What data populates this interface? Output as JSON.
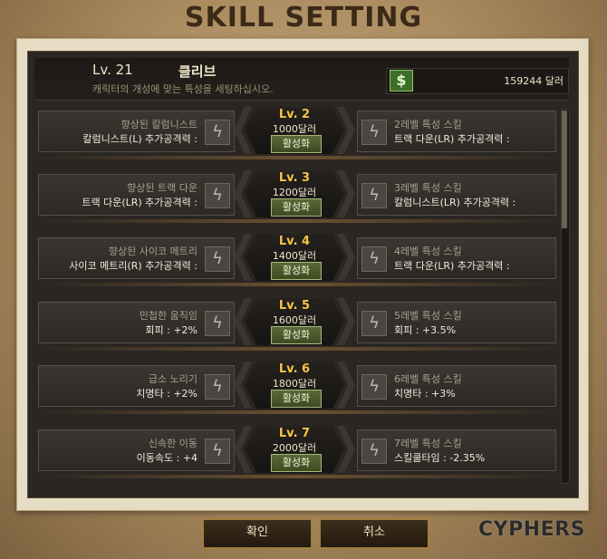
{
  "title": "SKILL SETTING",
  "header": {
    "level": "Lv. 21",
    "character": "클리브",
    "description": "캐릭터의 개성에 맞는 특성을 세팅하십시오.",
    "money": "159244 달러",
    "money_icon": "dollar-icon"
  },
  "rows": [
    {
      "level": "Lv. 2",
      "cost": "1000달러",
      "action": "활성화",
      "left_title": "향상된 칼럼니스트",
      "left_stat": "칼럼니스트(L) 추가공격력 :",
      "right_title": "2레벨 특성 스킬",
      "right_stat": "트랙 다운(LR) 추가공격력 :"
    },
    {
      "level": "Lv. 3",
      "cost": "1200달러",
      "action": "활성화",
      "left_title": "향상된 트랙 다운",
      "left_stat": "트랙 다운(LR) 추가공격력 :",
      "right_title": "3레벨 특성 스킬",
      "right_stat": "칼럼니스트(LR) 추가공격력 :"
    },
    {
      "level": "Lv. 4",
      "cost": "1400달러",
      "action": "활성화",
      "left_title": "향상된 사이코 메트리",
      "left_stat": "사이코 메트리(R) 추가공격력 :",
      "right_title": "4레벨 특성 스킬",
      "right_stat": "트랙 다운(LR) 추가공격력 :"
    },
    {
      "level": "Lv. 5",
      "cost": "1600달러",
      "action": "활성화",
      "left_title": "민첩한 움직임",
      "left_stat": "회피 : +2%",
      "right_title": "5레벨 특성 스킬",
      "right_stat": "회피 : +3.5%"
    },
    {
      "level": "Lv. 6",
      "cost": "1800달러",
      "action": "활성화",
      "left_title": "급소 노리기",
      "left_stat": "치명타 : +2%",
      "right_title": "6레벨 특성 스킬",
      "right_stat": "치명타 : +3%"
    },
    {
      "level": "Lv. 7",
      "cost": "2000달러",
      "action": "활성화",
      "left_title": "신속한 이동",
      "left_stat": "이동속도 : +4",
      "right_title": "7레벨 특성 스킬",
      "right_stat": "스킬쿨타임 : -2.35%"
    }
  ],
  "buttons": {
    "ok": "확인",
    "cancel": "취소"
  },
  "logo": "CYPHERS",
  "icons": {
    "skill": "lightning-bolt-icon"
  }
}
